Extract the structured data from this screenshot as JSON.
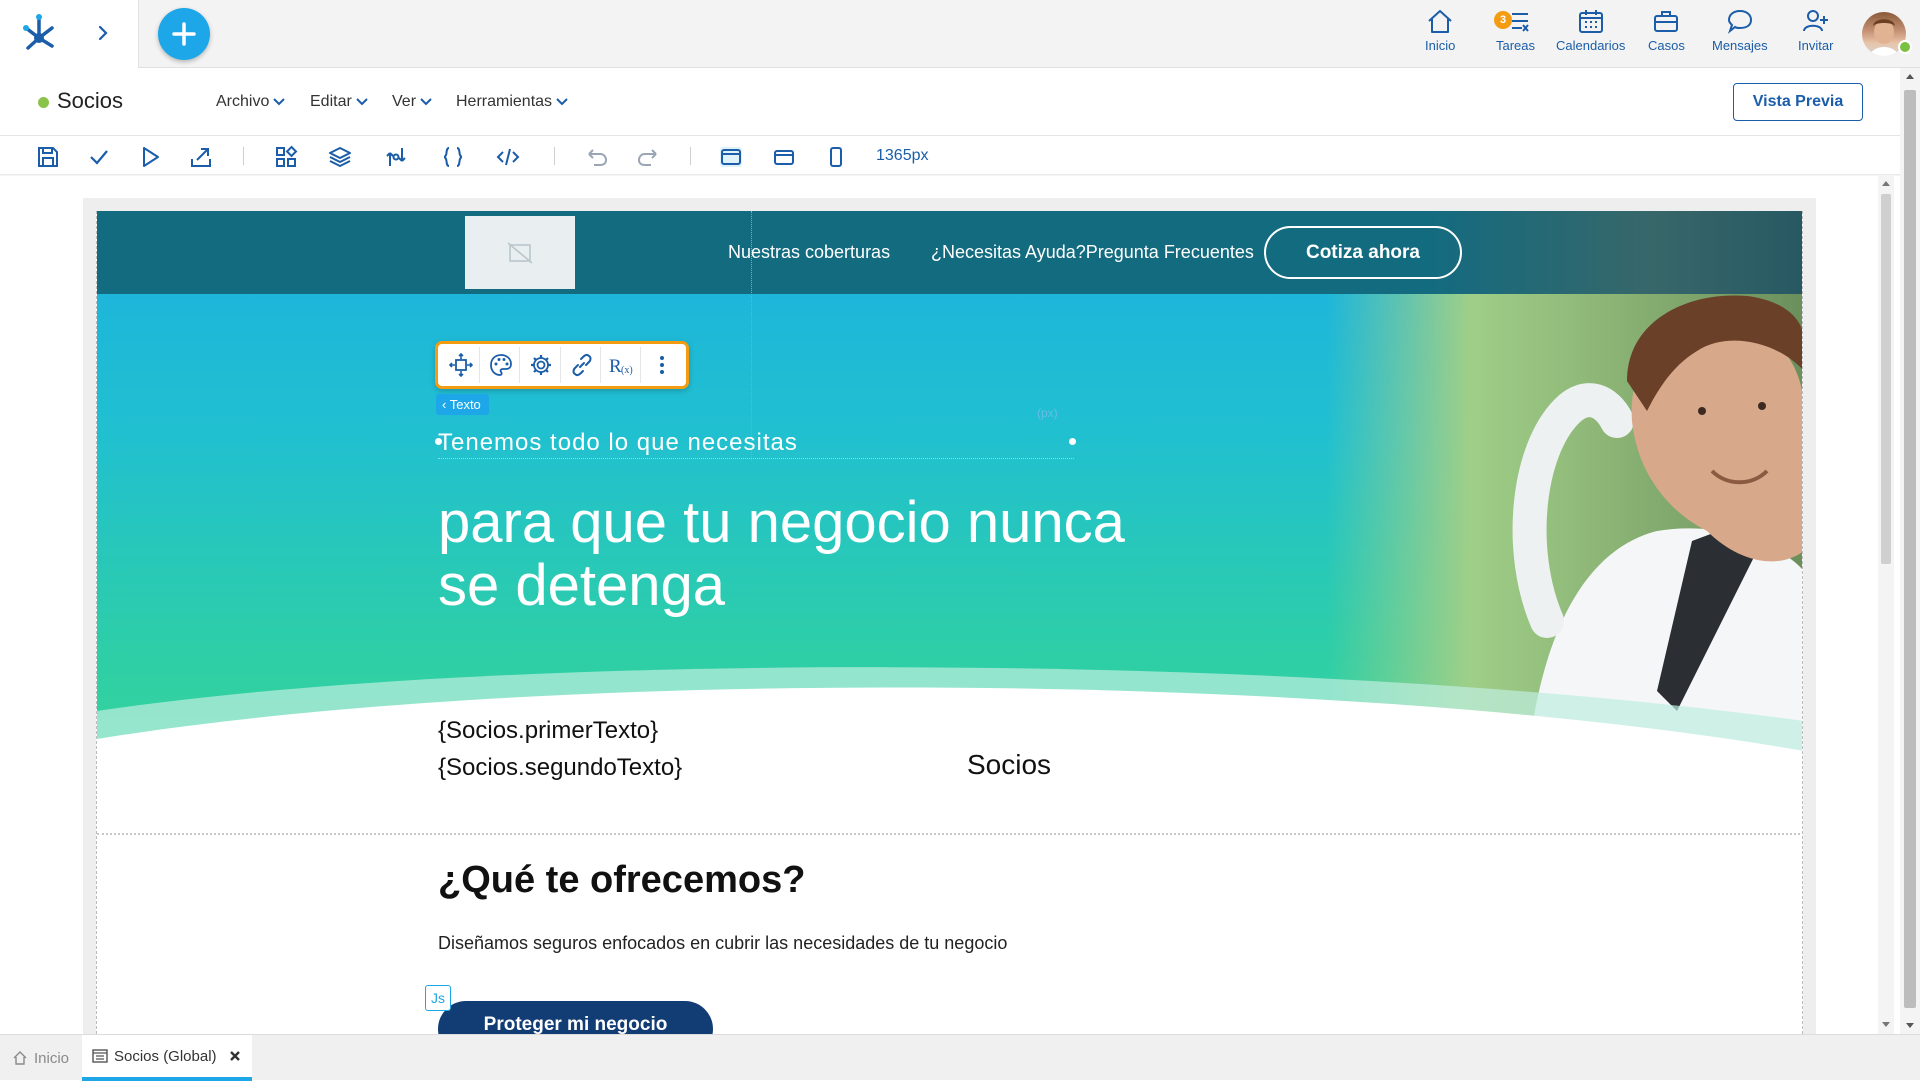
{
  "topbar": {
    "nav": [
      {
        "label": "Inicio",
        "icon": "home-icon"
      },
      {
        "label": "Tareas",
        "icon": "tasks-icon",
        "badge": "3"
      },
      {
        "label": "Calendarios",
        "icon": "calendar-icon"
      },
      {
        "label": "Casos",
        "icon": "briefcase-icon"
      },
      {
        "label": "Mensajes",
        "icon": "chat-icon"
      },
      {
        "label": "Invitar",
        "icon": "invite-user-icon"
      }
    ]
  },
  "menubar": {
    "title": "Socios",
    "menus": [
      "Archivo",
      "Editar",
      "Ver",
      "Herramientas"
    ],
    "preview_label": "Vista Previa"
  },
  "toolbar": {
    "width_readout": "1365px"
  },
  "site": {
    "nav": {
      "coverage": "Nuestras coberturas",
      "help": "¿Necesitas Ayuda?Pregunta Frecuentes",
      "cta": "Cotiza ahora"
    },
    "editor": {
      "element_tag": "Texto",
      "px_label": "(px)",
      "js_tag": "Js"
    },
    "hero": {
      "subtitle": "Tenemos todo lo que necesitas",
      "title": "para que tu negocio nunca se detenga"
    },
    "vars": {
      "first": "{Socios.primerTexto}",
      "second": "{Socios.segundoTexto}",
      "label": "Socios"
    },
    "offer": {
      "title": "¿Qué te ofrecemos?",
      "description": "Diseñamos seguros enfocados en cubrir las necesidades de tu negocio",
      "button": "Proteger mi negocio"
    }
  },
  "tabs": [
    {
      "label": "Inicio",
      "active": false
    },
    {
      "label": "Socios (Global)",
      "active": true
    }
  ],
  "colors": {
    "accent": "#1ea7e8",
    "brand_blue": "#1b5da8",
    "site_header": "#136b80",
    "selection": "#f39c12",
    "button_dark": "#123c74"
  }
}
